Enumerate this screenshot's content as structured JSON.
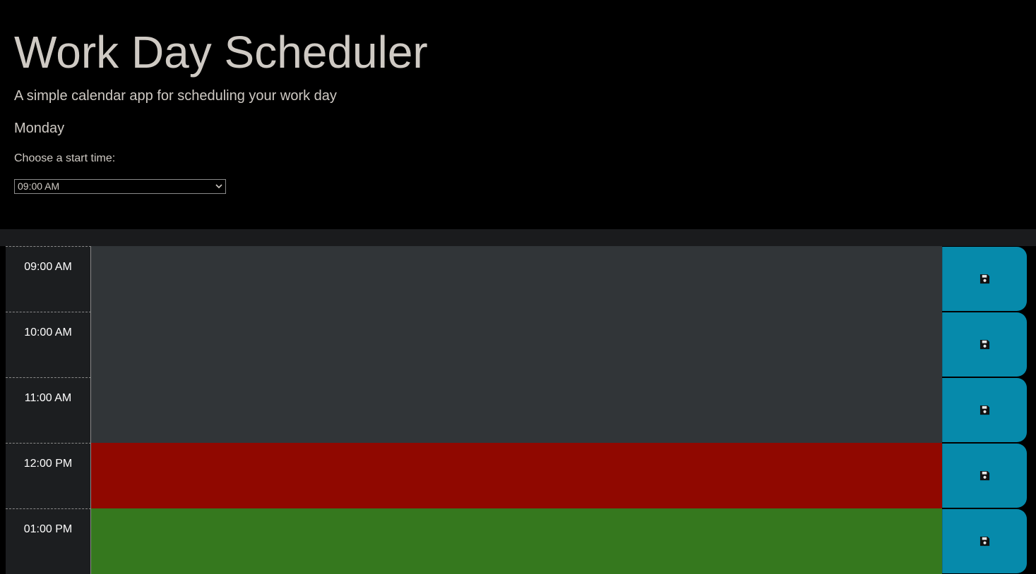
{
  "header": {
    "title": "Work Day Scheduler",
    "subtitle": "A simple calendar app for scheduling your work day",
    "day": "Monday",
    "start_label": "Choose a start time:",
    "start_selected": "09:00 AM"
  },
  "colors": {
    "past": "#313538",
    "present": "#900800",
    "future": "#35781e",
    "save_button": "#068aab",
    "hour_cell": "#1c1e20"
  },
  "schedule": {
    "rows": [
      {
        "hour": "09:00 AM",
        "status": "past",
        "text": "",
        "save_icon": "floppy-disk-icon"
      },
      {
        "hour": "10:00 AM",
        "status": "past",
        "text": "",
        "save_icon": "floppy-disk-icon"
      },
      {
        "hour": "11:00 AM",
        "status": "past",
        "text": "",
        "save_icon": "floppy-disk-icon"
      },
      {
        "hour": "12:00 PM",
        "status": "present",
        "text": "",
        "save_icon": "floppy-disk-icon"
      },
      {
        "hour": "01:00 PM",
        "status": "future",
        "text": "",
        "save_icon": "floppy-disk-icon"
      }
    ]
  }
}
